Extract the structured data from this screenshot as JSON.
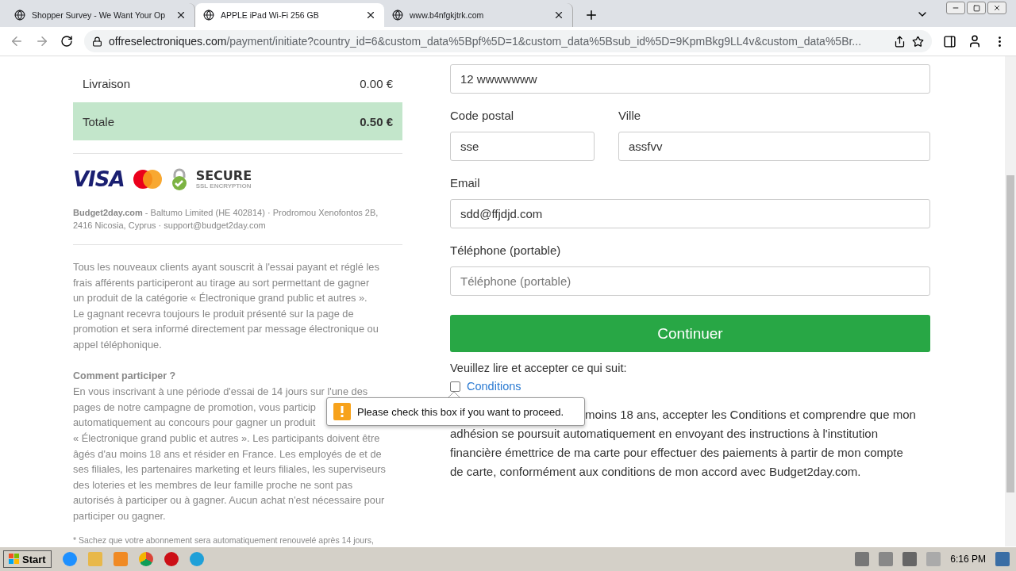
{
  "browser": {
    "tabs": [
      {
        "title": "Shopper Survey - We Want Your Op",
        "selected": false
      },
      {
        "title": "APPLE iPad Wi-Fi 256 GB",
        "selected": true
      },
      {
        "title": "www.b4nfgkjtrk.com",
        "selected": false
      }
    ],
    "address": {
      "domain": "offreselectroniques.com",
      "path": "/payment/initiate?country_id=6&custom_data%5Bpf%5D=1&custom_data%5Bsub_id%5D=9KpmBkg9LL4v&custom_data%5Br..."
    }
  },
  "summary": [
    {
      "label": "Livraison",
      "value": "0.00 €",
      "highlighted": false
    },
    {
      "label": "Totale",
      "value": "0.50 €",
      "highlighted": true
    }
  ],
  "logos": {
    "card": "VISA",
    "secure": "SECURE",
    "secure_sub": "SSL ENCRYPTION"
  },
  "company": "**Budget2day.com** - Baltumo Limited (HE 402814) · Prodromou Xenofontos 2B, 2416 Nicosia, Cyprus · support@budget2day.com",
  "info": "Tous les nouveaux clients ayant souscrit à l'essai payant et réglé les frais afférents participeront au tirage au sort permettant de gagner un produit de la catégorie « Électronique grand public et autres ». Le gagnant recevra toujours le produit présenté sur la page de promotion et sera informé directement par message électronique ou appel téléphonique.",
  "how_to": {
    "heading": "Comment participer ?",
    "lines": [
      "En vous inscrivant à une période d'essai de 14 jours sur l'une des",
      "pages de notre campagne de promotion, vous particip",
      "automatiquement au concours pour gagner un produit",
      "« Électronique grand public et autres ». Les participants doivent être",
      "âgés d'au moins 18 ans et résider en France. Les employés de et de",
      "ses filiales, les partenaires marketing et leurs filiales, les superviseurs",
      "des loteries et les membres de leur famille proche ne sont pas",
      "autorisés à participer ou à gagner. Aucun achat n'est nécessaire pour",
      "participer ou gagner."
    ]
  },
  "footnote": "* Sachez que votre abonnement sera automatiquement renouvelé après 14 jours,",
  "form": {
    "rows": [
      [
        {
          "value": "12 wwwwwww"
        }
      ],
      [
        {
          "label": "Code postal",
          "value": "sse"
        },
        {
          "label": "Ville",
          "value": "assfvv"
        }
      ],
      [
        {
          "label": "Email",
          "value": "sdd@ffjdjd.com"
        }
      ],
      [
        {
          "label": "Téléphone (portable)",
          "placeholder": "Téléphone (portable)"
        }
      ]
    ],
    "button": "Continuer"
  },
  "consent": {
    "prompt": "Veuillez lire et accepter ce qui suit:",
    "checkbox": {
      "label": "Conditions",
      "checked": false
    },
    "terms_lines": [
      "moins 18 ans, accepter les Conditions et comprendre que mon",
      "adhésion se poursuit automatiquement en envoyant des instructions à l'institution",
      "financière émettrice de ma carte pour effectuer des paiements à partir de mon compte",
      "de carte, conformément aux conditions de mon accord avec Budget2day.com."
    ]
  },
  "tooltip": "Please check this box if you want to proceed.",
  "taskbar": {
    "start": "Start",
    "clock": "6:16 PM"
  }
}
